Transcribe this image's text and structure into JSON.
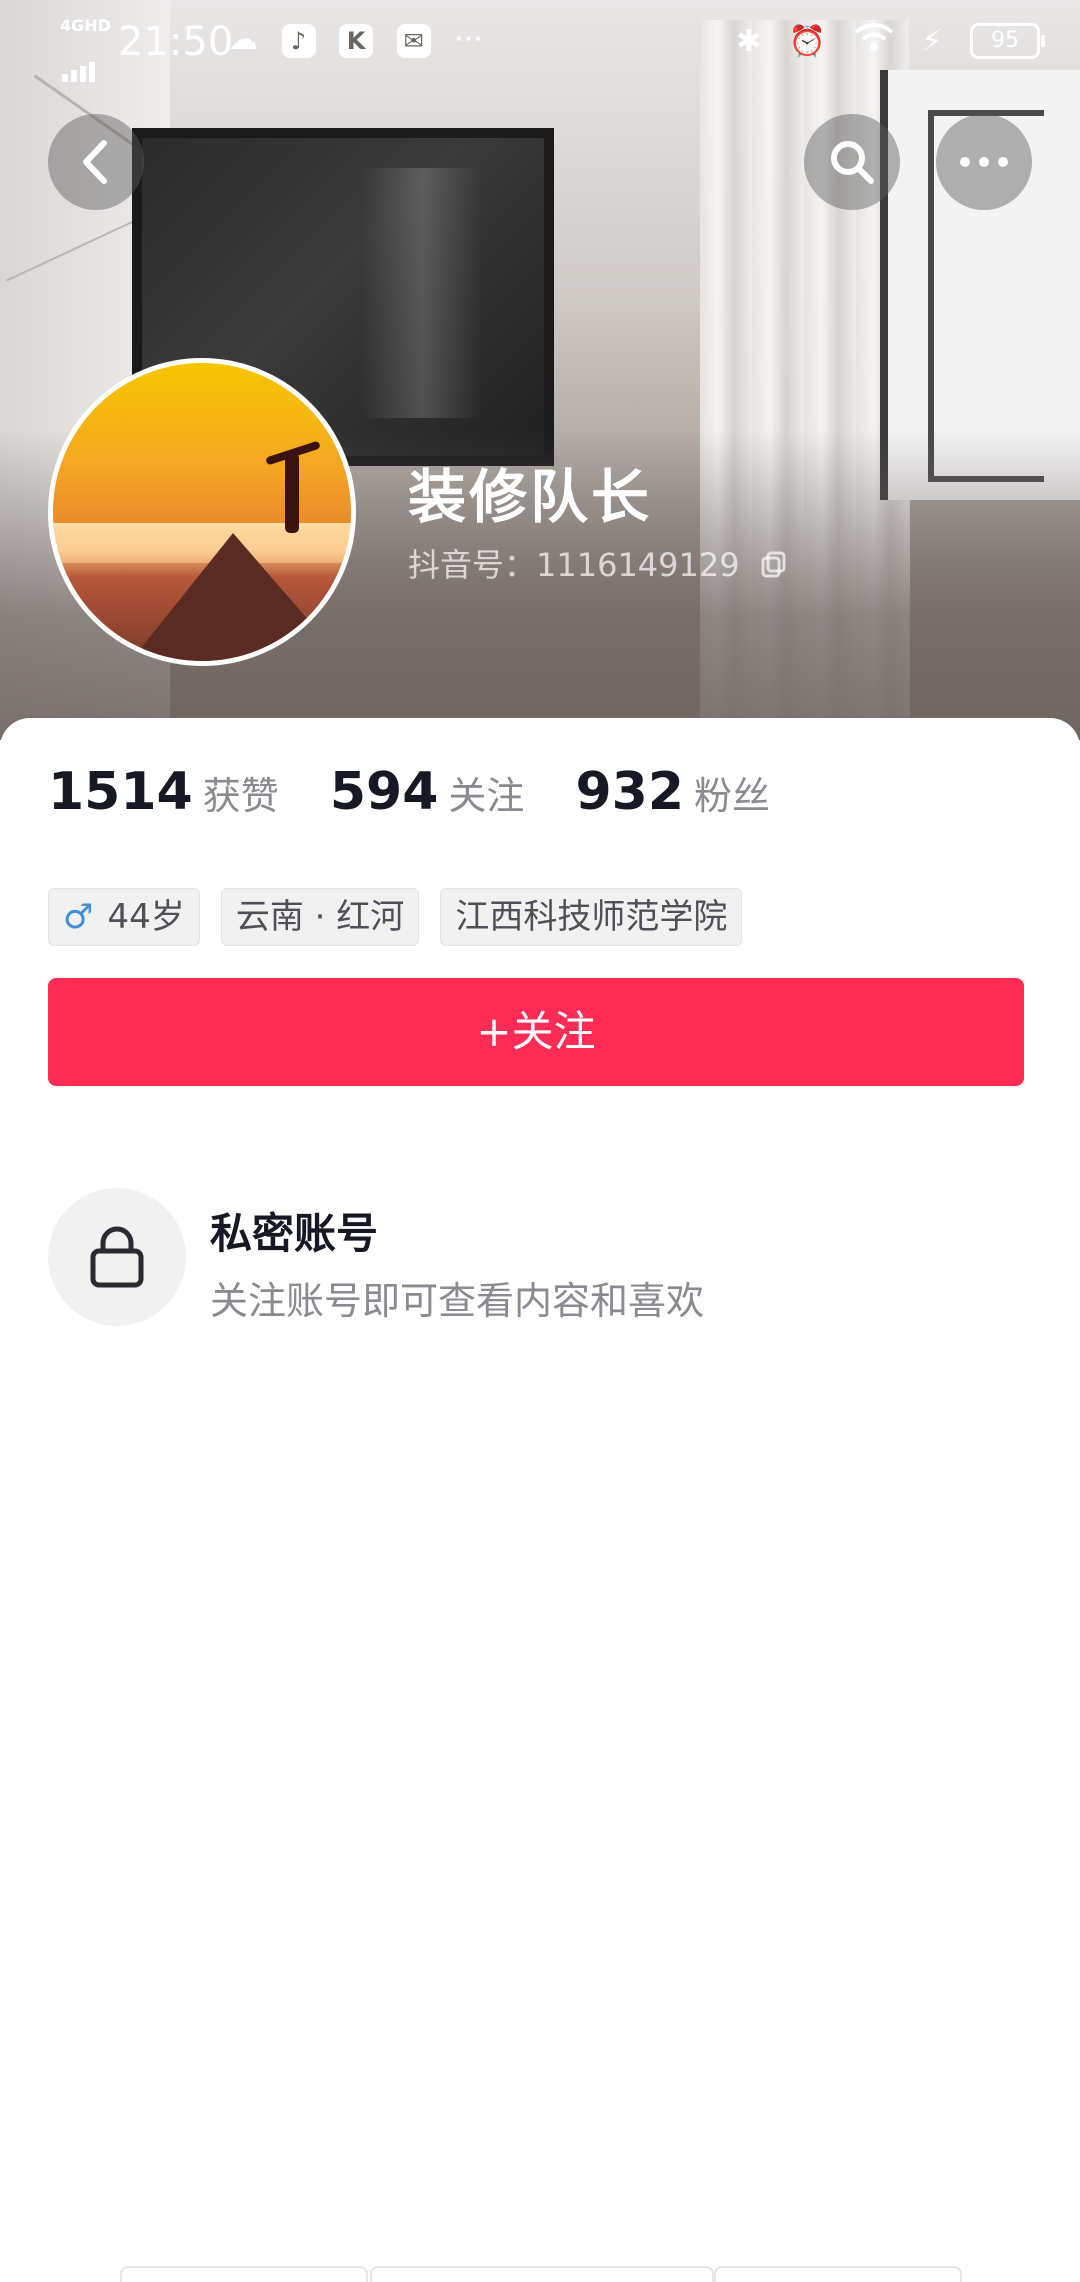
{
  "status_bar": {
    "network": "4GHD",
    "time": "21:50",
    "app_icons": [
      "weather-cloud-icon",
      "tiktok-icon",
      "k-app-icon",
      "mail-app-icon"
    ],
    "more": "···",
    "battery": "95"
  },
  "nav": {
    "back": "back-icon",
    "search": "search-icon",
    "more": "more-icon"
  },
  "profile": {
    "name": "装修队长",
    "douyin_id": "抖音号：1116149129"
  },
  "stats": [
    {
      "value": "1514",
      "label": "获赞"
    },
    {
      "value": "594",
      "label": "关注"
    },
    {
      "value": "932",
      "label": "粉丝"
    }
  ],
  "tags": {
    "gender_symbol": "♂",
    "age": "44岁",
    "location": "云南 · 红河",
    "school": "江西科技师范学院"
  },
  "follow_button": "+关注",
  "private": {
    "title": "私密账号",
    "desc": "关注账号即可查看内容和喜欢"
  },
  "colors": {
    "accent": "#fe2c55",
    "text_primary": "#161823",
    "text_secondary": "#8a8b91"
  }
}
